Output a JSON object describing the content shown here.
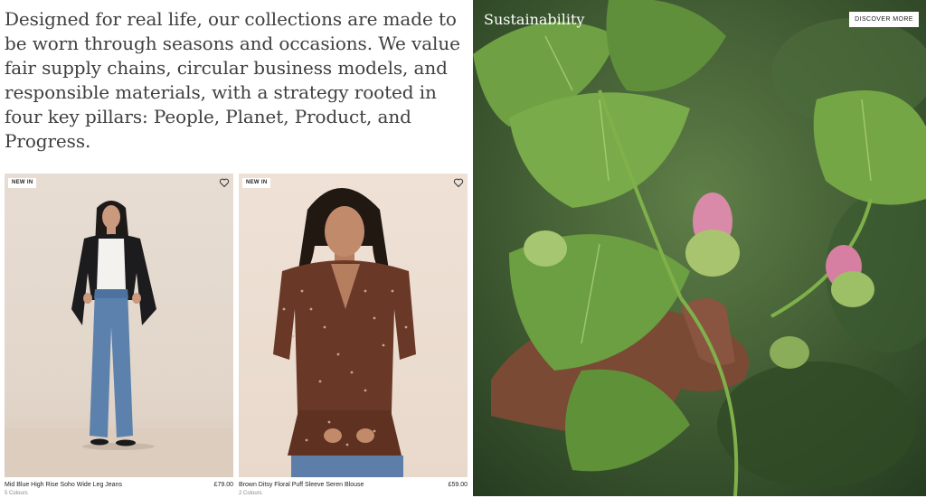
{
  "intro": {
    "text": "Designed for real life, our collections are made to be worn through seasons and occasions. We value fair supply chains, circular business models, and responsible materials, with a strategy rooted in four key pillars: People, Planet, Product, and Progress."
  },
  "products": [
    {
      "badge": "NEW IN",
      "name": "Mid Blue High Rise Soho Wide Leg Jeans",
      "price": "£79.00",
      "subtext": "5 Colours"
    },
    {
      "badge": "NEW IN",
      "name": "Brown Ditsy Floral Puff Sleeve Seren Blouse",
      "price": "£59.00",
      "subtext": "2 Colours"
    }
  ],
  "sustainability": {
    "title": "Sustainability",
    "button_label": "DISCOVER MORE"
  },
  "icons": {
    "wishlist": "heart-icon"
  }
}
